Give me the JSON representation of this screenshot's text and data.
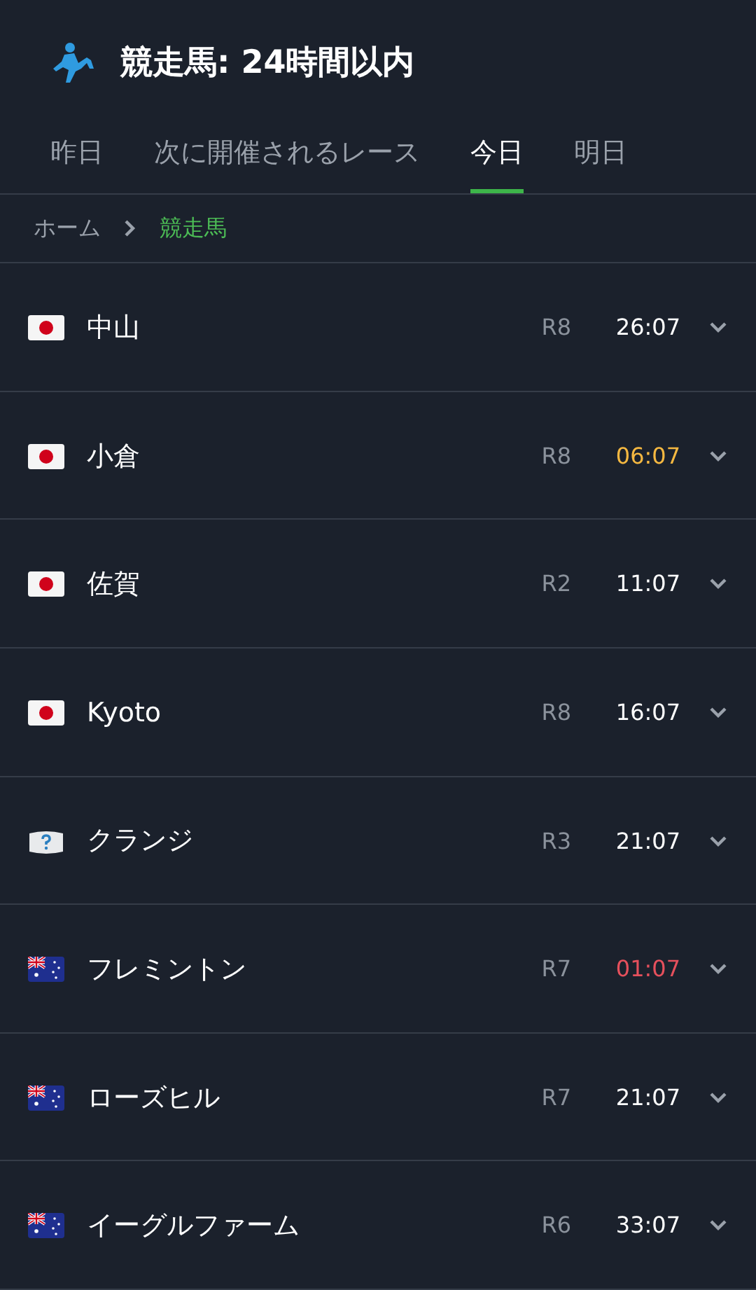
{
  "header": {
    "title": "競走馬: 24時間以内"
  },
  "tabs": [
    {
      "label": "昨日",
      "selected": false
    },
    {
      "label": "次に開催されるレース",
      "selected": false
    },
    {
      "label": "今日",
      "selected": true
    },
    {
      "label": "明日",
      "selected": false
    }
  ],
  "breadcrumb": [
    {
      "label": "ホーム",
      "current": false
    },
    {
      "label": "競走馬",
      "current": true
    }
  ],
  "races": [
    {
      "kind": "japan",
      "venue": "中山",
      "race": "R8",
      "time": "26:07",
      "color": "#ffffff"
    },
    {
      "kind": "japan",
      "venue": "小倉",
      "race": "R8",
      "time": "06:07",
      "color": "#f5b841"
    },
    {
      "kind": "japan",
      "venue": "佐賀",
      "race": "R2",
      "time": "11:07",
      "color": "#ffffff"
    },
    {
      "kind": "japan",
      "venue": "Kyoto",
      "race": "R8",
      "time": "16:07",
      "color": "#ffffff"
    },
    {
      "kind": "unknown",
      "venue": "クランジ",
      "race": "R3",
      "time": "21:07",
      "color": "#ffffff"
    },
    {
      "kind": "australia",
      "venue": "フレミントン",
      "race": "R7",
      "time": "01:07",
      "color": "#e5505c"
    },
    {
      "kind": "australia",
      "venue": "ローズヒル",
      "race": "R7",
      "time": "21:07",
      "color": "#ffffff"
    },
    {
      "kind": "australia",
      "venue": "イーグルファーム",
      "race": "R6",
      "time": "33:07",
      "color": "#ffffff"
    }
  ]
}
